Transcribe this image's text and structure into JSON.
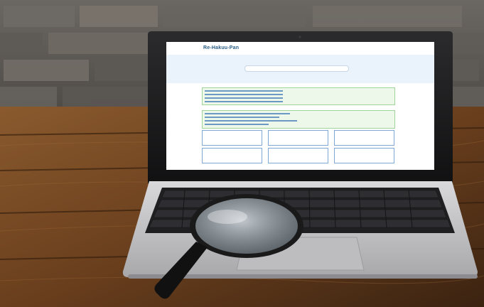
{
  "scene": {
    "description_colors": {
      "wall": "#5b5854",
      "mortar": "#9a958d",
      "desk": "#6a3f1d",
      "laptop_body": "#c9c9cb",
      "keyboard": "#1f1f22",
      "screen_bezel": "#111111"
    }
  },
  "screen": {
    "logo": "Re-Hakuu-Pan",
    "login_link": "",
    "search_placeholder": "",
    "cards": [
      {
        "title": "",
        "sub": ""
      },
      {
        "title": "",
        "sub": ""
      },
      {
        "title": "",
        "sub": ""
      },
      {
        "title": "",
        "sub": ""
      },
      {
        "title": "",
        "sub": ""
      },
      {
        "title": "",
        "sub": ""
      }
    ]
  }
}
